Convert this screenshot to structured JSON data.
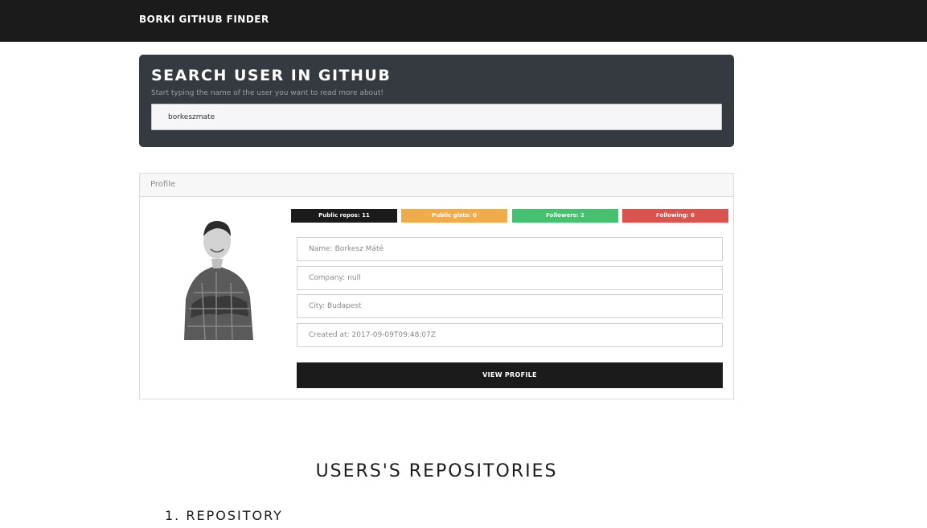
{
  "navbar": {
    "brand": "BORKI GITHUB FINDER"
  },
  "search": {
    "title": "SEARCH USER IN GITHUB",
    "subtitle": "Start typing the name of the user you want to read more about!",
    "value": "borkeszmate"
  },
  "profile": {
    "header": "Profile",
    "badges": {
      "repos": "Public repos: 11",
      "gists": "Public gists: 0",
      "followers": "Followers: 2",
      "following": "Following: 6"
    },
    "fields": {
      "name_label": "Name:",
      "name": "Borkesz Máté",
      "company_label": "Company:",
      "company": "null",
      "city_label": "City:",
      "city": "Budapest",
      "created_label": "Created at:",
      "created": "2017-09-09T09:48:07Z"
    },
    "view_button": "VIEW PROFILE",
    "badge_colors": {
      "repos": "#1b1b1b",
      "gists": "#efac4d",
      "followers": "#47c16f",
      "following": "#d9534f"
    }
  },
  "repos": {
    "title": "USERS'S REPOSITORIES",
    "items": [
      "1. REPOSITORY"
    ]
  }
}
